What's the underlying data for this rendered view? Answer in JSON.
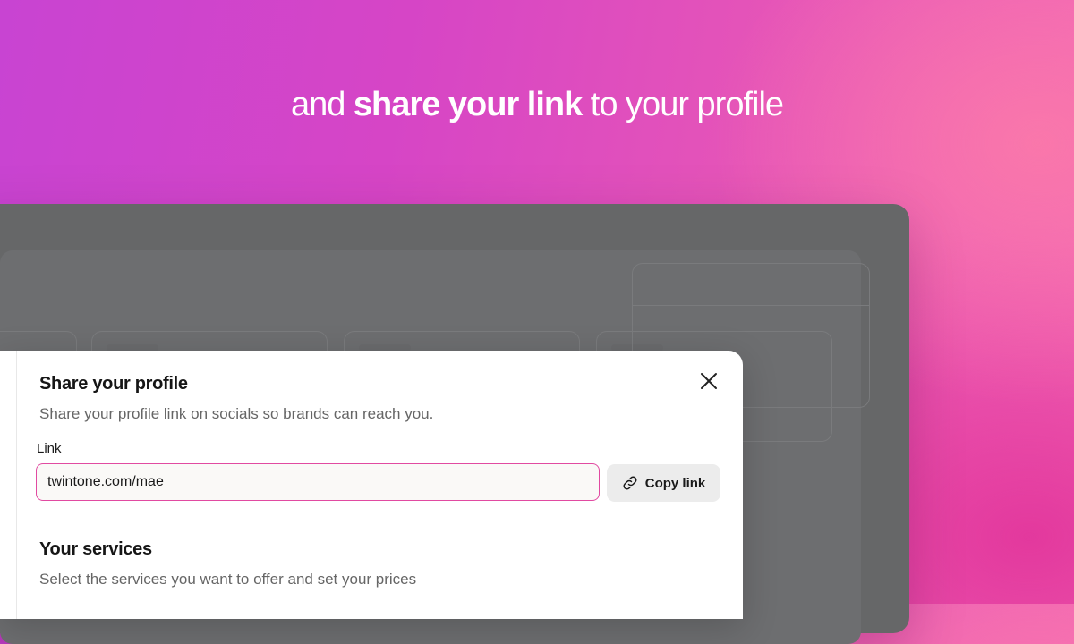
{
  "hero": {
    "prefix": "and ",
    "emphasis": "share your link",
    "suffix": " to your profile"
  },
  "modal": {
    "title": "Share your profile",
    "subtitle": "Share your profile link on socials so brands can reach you.",
    "link_label": "Link",
    "link_value": "twintone.com/mae",
    "copy_button_label": "Copy link",
    "close_icon": "close-icon",
    "copy_icon": "link-icon"
  },
  "services": {
    "title": "Your services",
    "subtitle": "Select the services you want to offer and set your prices"
  },
  "colors": {
    "accent": "#e14aa1",
    "gradient_start": "#c844d2",
    "gradient_end": "#f46ab6",
    "app_background": "#666768"
  }
}
